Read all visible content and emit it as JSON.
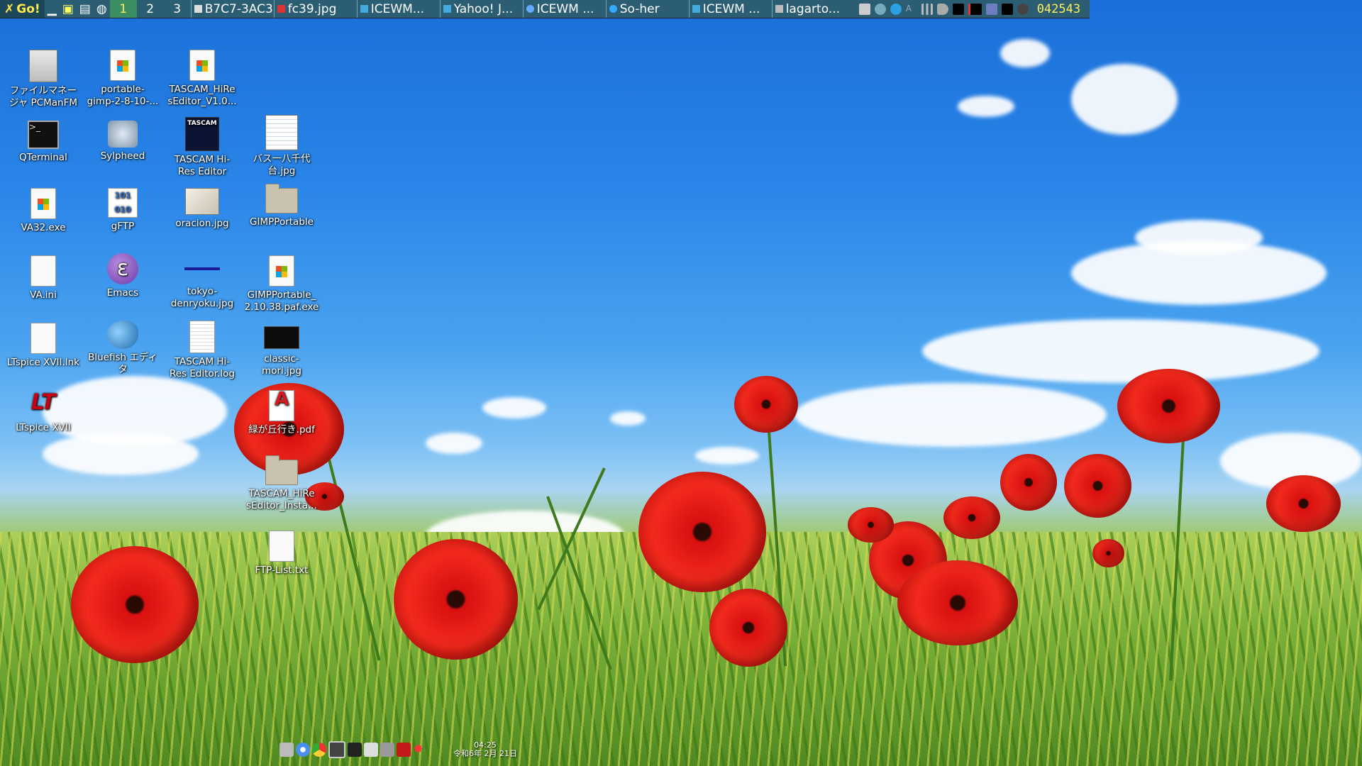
{
  "taskbar": {
    "start_label": "Go!",
    "workspaces": [
      "1",
      "2",
      "3"
    ],
    "active_workspace": "1",
    "tasks": [
      "B7C7-3AC3",
      "fc39.jpg",
      "ICEWM...",
      "Yahoo! J...",
      "ICEWM ...",
      "So-her",
      "ICEWM ...",
      "lagarto..."
    ],
    "clock": "042543"
  },
  "desktop_icons": [
    {
      "label": "ファイルマネー\nジャ PCManFM",
      "icon": "file-cabinet-icon"
    },
    {
      "label": "portable-\ngimp-2-8-10-...",
      "icon": "windows-exe-icon"
    },
    {
      "label": "TASCAM_HiRe\nsEditor_V1.0...",
      "icon": "windows-exe-icon"
    },
    {
      "label": "QTerminal",
      "icon": "terminal-icon"
    },
    {
      "label": "Sylpheed",
      "icon": "sylpheed-icon"
    },
    {
      "label": "TASCAM Hi-\nRes Editor",
      "icon": "tascam-icon"
    },
    {
      "label": "バス一八千代\n台.jpg",
      "icon": "image-file-icon"
    },
    {
      "label": "VA32.exe",
      "icon": "windows-exe-icon"
    },
    {
      "label": "gFTP",
      "icon": "gftp-icon"
    },
    {
      "label": "oracion.jpg",
      "icon": "image-file-icon"
    },
    {
      "label": "GIMPPortable",
      "icon": "folder-icon"
    },
    {
      "label": "VA.ini",
      "icon": "text-file-icon"
    },
    {
      "label": "Emacs",
      "icon": "emacs-icon"
    },
    {
      "label": "tokyo-\ndenryoku.jpg",
      "icon": "image-file-icon"
    },
    {
      "label": "GIMPPortable_\n2.10.38.paf.exe",
      "icon": "windows-exe-icon"
    },
    {
      "label": "LTspice XVII.lnk",
      "icon": "blank-file-icon"
    },
    {
      "label": "Bluefish エディ\nタ",
      "icon": "bluefish-icon"
    },
    {
      "label": "TASCAM Hi-\nRes Editor.log",
      "icon": "log-file-icon"
    },
    {
      "label": "classic-\nmori.jpg",
      "icon": "image-file-icon"
    },
    {
      "label": "LTspice XVII",
      "icon": "ltspice-icon"
    },
    {
      "label": "緑が丘行き.pdf",
      "icon": "pdf-icon"
    },
    {
      "label": "TASCAM_HiRe\nsEditor_Insta...",
      "icon": "folder-icon"
    },
    {
      "label": "FTP-List.txt",
      "icon": "text-file-icon"
    }
  ],
  "dock": {
    "clock_time": "04:25",
    "clock_date": "令和6年 2月 21日"
  },
  "colors": {
    "taskbar_bg": "#2b5d73",
    "active_workspace": "#3a8f63",
    "clock_text": "#ffef5a"
  }
}
